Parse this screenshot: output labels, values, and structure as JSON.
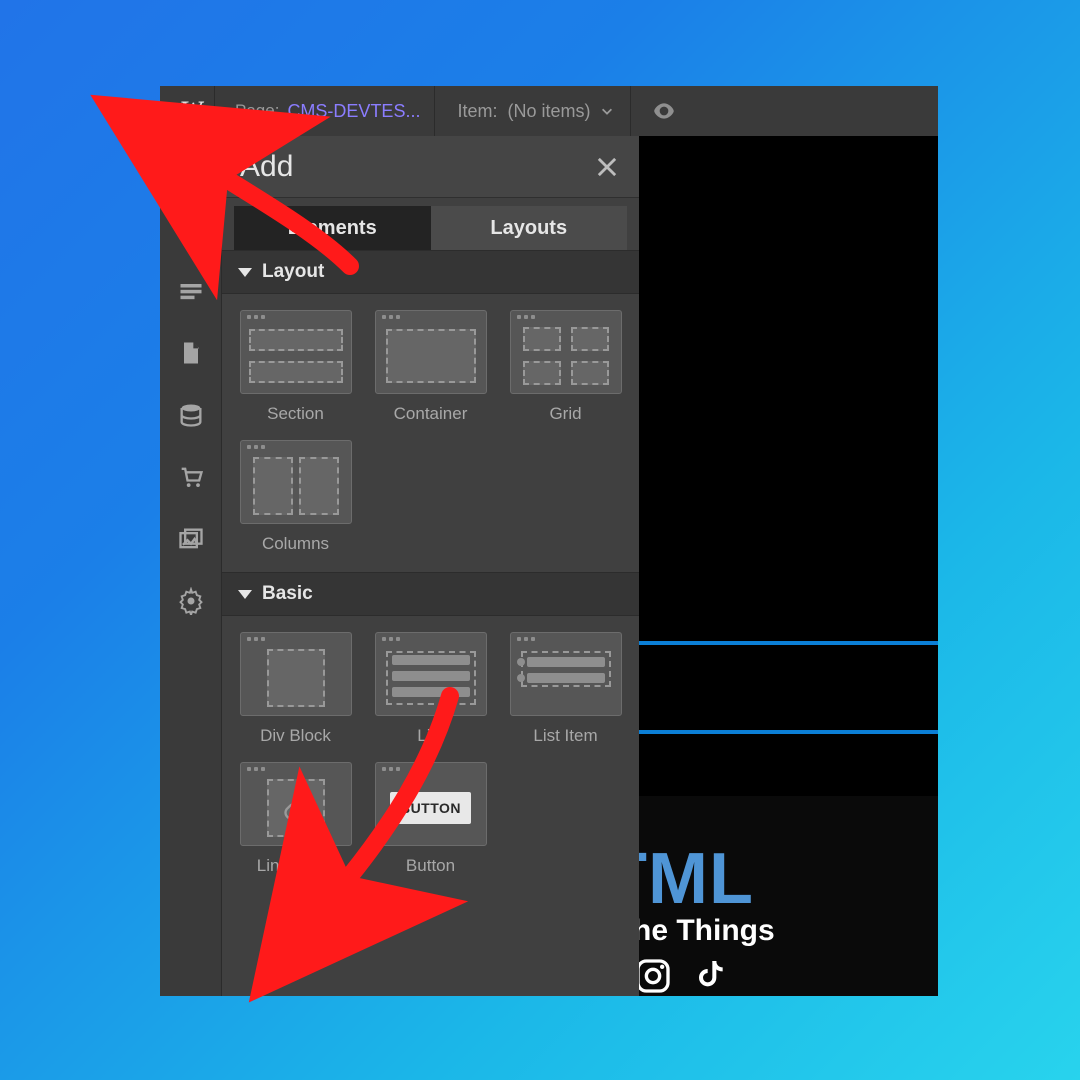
{
  "topbar": {
    "page_label": "Page:",
    "page_value": "CMS-DEVTES...",
    "item_label": "Item:",
    "item_value": "(No items)"
  },
  "panel": {
    "title": "Add",
    "tabs": {
      "elements": "Elements",
      "layouts": "Layouts"
    },
    "sections": {
      "layout": {
        "title": "Layout",
        "items": [
          "Section",
          "Container",
          "Grid",
          "Columns"
        ]
      },
      "basic": {
        "title": "Basic",
        "items": [
          "Div Block",
          "List",
          "List Item",
          "Link Block",
          "Button"
        ],
        "button_label": "BUTTON"
      }
    }
  },
  "canvas": {
    "title_fragment": "TML",
    "subtitle_fragment": "he Things"
  }
}
